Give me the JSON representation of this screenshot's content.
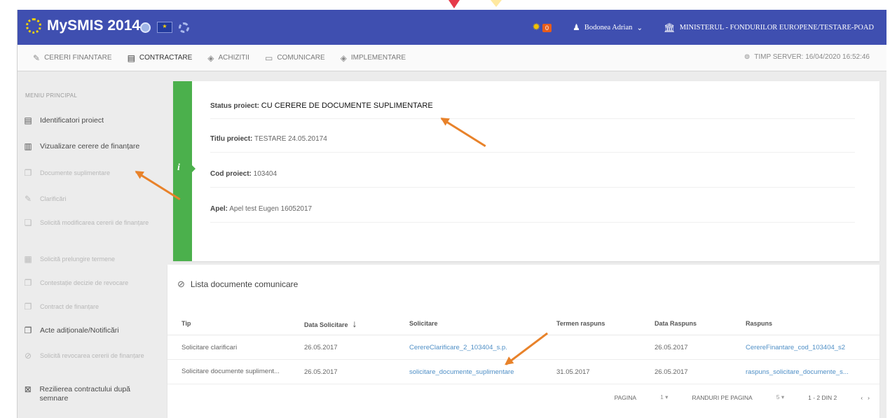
{
  "app": {
    "title": "MySMIS 2014"
  },
  "topbar": {
    "notification_count": "0",
    "user_name": "Bodonea Adrian",
    "ministry": "MINISTERUL  -  FONDURILOR EUROPENE/TESTARE-POAD"
  },
  "menu": {
    "items": [
      {
        "label": "CERERI FINANTARE",
        "icon": "pencil-icon"
      },
      {
        "label": "CONTRACTARE",
        "icon": "document-icon"
      },
      {
        "label": "ACHIZITII",
        "icon": "layers-icon"
      },
      {
        "label": "COMUNICARE",
        "icon": "chat-icon"
      },
      {
        "label": "IMPLEMENTARE",
        "icon": "layers-icon"
      }
    ],
    "server_time": "TIMP SERVER: 16/04/2020 16:52:46"
  },
  "sidebar": {
    "title": "MENIU PRINCIPAL",
    "items": [
      {
        "label": "Identificatori proiect",
        "icon": "document-icon",
        "enabled": true
      },
      {
        "label": "Vizualizare cerere de finanțare",
        "icon": "book-icon",
        "enabled": true
      },
      {
        "label": "Documente suplimentare",
        "icon": "copy-icon",
        "enabled": false
      },
      {
        "label": "Clarificări",
        "icon": "pencil-icon",
        "enabled": false
      },
      {
        "label": "Solicită modificarea cererii de finanțare",
        "icon": "edit-document-icon",
        "enabled": false
      },
      {
        "label": "Solicită prelungire termene",
        "icon": "calendar-icon",
        "enabled": false
      },
      {
        "label": "Contestație decizie de revocare",
        "icon": "copy-icon",
        "enabled": false
      },
      {
        "label": "Contract de finanțare",
        "icon": "copy-icon",
        "enabled": false
      },
      {
        "label": "Acte adiționale/Notificări",
        "icon": "copy-icon",
        "enabled": true
      },
      {
        "label": "Solicită revocarea cererii de finanțare",
        "icon": "block-icon",
        "enabled": false
      },
      {
        "label": "Rezilierea contractului după semnare",
        "icon": "close-box-icon",
        "enabled": true
      }
    ]
  },
  "project": {
    "status_label": "Status proiect:",
    "status_value": "CU CERERE DE DOCUMENTE SUPLIMENTARE",
    "title_label": "Titlu proiect:",
    "title_value": "TESTARE 24.05.20174",
    "code_label": "Cod proiect:",
    "code_value": "103404",
    "call_label": "Apel:",
    "call_value": "Apel test Eugen 16052017"
  },
  "documents": {
    "title": "Lista documente comunicare",
    "columns": [
      "Tip",
      "Data Solicitare",
      "Solicitare",
      "Termen raspuns",
      "Data Raspuns",
      "Raspuns"
    ],
    "rows": [
      [
        "Solicitare clarificari",
        "26.05.2017",
        "CerereClarificare_2_103404_s.p.",
        "",
        "26.05.2017",
        "CerereFinantare_cod_103404_s2"
      ],
      [
        "Solicitare documente supliment...",
        "26.05.2017",
        "solicitare_documente_suplimentare",
        "31.05.2017",
        "26.05.2017",
        "raspuns_solicitare_documente_s..."
      ]
    ],
    "pager": {
      "page_label": "PAGINA",
      "page_value": "1",
      "rows_label": "RANDURI PE PAGINA",
      "rows_value": "5",
      "range": "1 - 2 DIN 2"
    }
  }
}
